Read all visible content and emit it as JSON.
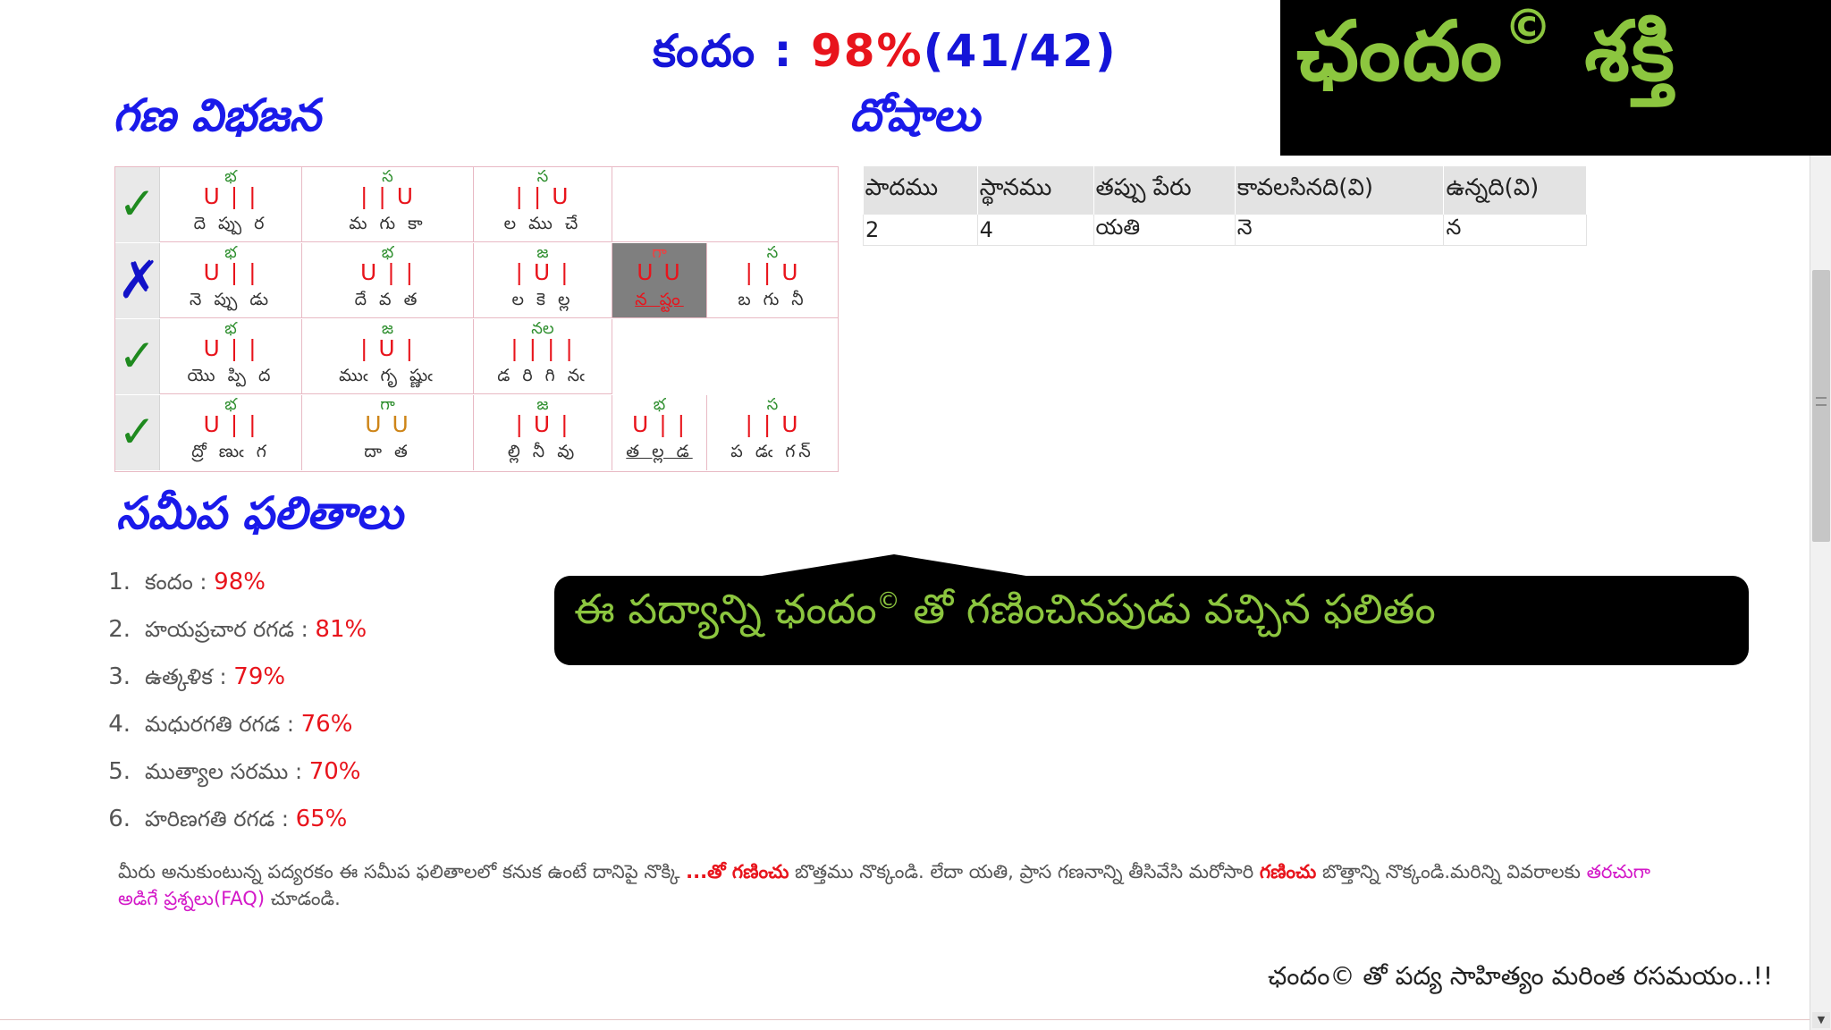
{
  "result": {
    "label": "కందం :",
    "percent": "98%",
    "count": "(41/42)"
  },
  "logo": {
    "main": "ఛందం",
    "copyright": "©",
    "suffix": "శక్తి"
  },
  "headings": {
    "gana_vibhajana": "గణ విభజన",
    "doshalu": "దోషాలు",
    "sameepa_phalitalu": "సమీప ఫలితాలు"
  },
  "gana_rows": [
    {
      "status": "✓",
      "ok": true,
      "cells": [
        {
          "name": "భ",
          "pattern": "U | |",
          "word": "దె ప్పు ర"
        },
        {
          "name": "స",
          "pattern": "| | U",
          "word": "మ గు కా"
        },
        {
          "name": "స",
          "pattern": "| | U",
          "word": "ల ము చే"
        }
      ]
    },
    {
      "status": "✗",
      "ok": false,
      "cells": [
        {
          "name": "భ",
          "pattern": "U | |",
          "word": "నె ప్పు డు"
        },
        {
          "name": "భ",
          "pattern": "U | |",
          "word": "దే వ త"
        },
        {
          "name": "జ",
          "pattern": "| U |",
          "word": "ల కె ల్ల"
        },
        {
          "name": "గా",
          "pattern": "U U",
          "word": "న ష్టం"
        },
        {
          "name": "స",
          "pattern": "| | U",
          "word": "బ గు నీ"
        }
      ]
    },
    {
      "status": "✓",
      "ok": true,
      "cells": [
        {
          "name": "భ",
          "pattern": "U | |",
          "word": "యొ ప్పి ద"
        },
        {
          "name": "జ",
          "pattern": "| U |",
          "word": "ముఁ గృ ష్ణుఁ"
        },
        {
          "name": "నల",
          "pattern": "| | | |",
          "word": "డ రి గి నఁ"
        }
      ]
    },
    {
      "status": "✓",
      "ok": true,
      "cells": [
        {
          "name": "భ",
          "pattern": "U | |",
          "word": "ద్రో ణుఁ గ"
        },
        {
          "name": "గా",
          "pattern": "U U",
          "word": "దా త"
        },
        {
          "name": "జ",
          "pattern": "| U |",
          "word": "ల్లి నీ వు"
        },
        {
          "name": "భ",
          "pattern": "U | |",
          "word": "త ల్ల డ"
        },
        {
          "name": "స",
          "pattern": "| | U",
          "word": "ప డఁ గన్"
        }
      ]
    }
  ],
  "dosha_table": {
    "headers": [
      "పాదము",
      "స్థానము",
      "తప్పు పేరు",
      "కావలసినది(వి)",
      "ఉన్నది(వి)"
    ],
    "rows": [
      [
        "2",
        "4",
        "యతి",
        "నె",
        "న"
      ]
    ]
  },
  "near_results": [
    {
      "num": "1.",
      "name": "కందం :",
      "pct": "98%"
    },
    {
      "num": "2.",
      "name": "హయప్రచార రగడ :",
      "pct": "81%"
    },
    {
      "num": "3.",
      "name": "ఉత్కళిక :",
      "pct": "79%"
    },
    {
      "num": "4.",
      "name": "మధురగతి రగడ :",
      "pct": "76%"
    },
    {
      "num": "5.",
      "name": "ముత్యాల సరము :",
      "pct": "70%"
    },
    {
      "num": "6.",
      "name": "హరిణగతి రగడ :",
      "pct": "65%"
    }
  ],
  "callout": {
    "before": "ఈ పద్యాన్ని ఛందం",
    "sup": "©",
    "after": " తో గణించినపుడు వచ్చిన ఫలితం"
  },
  "instructions": {
    "part1": "మీరు అనుకుంటున్న పద్యరకం ఈ సమీప ఫలితాలలో కనుక ఉంటే దానిపై నొక్కి ",
    "btn1": "...తో గణించు",
    "part2": " బొత్తము నొక్కండి. లేదా యతి, ప్రాస గణనాన్ని తీసివేసి మరోసారి ",
    "btn2": "గణించు",
    "part3": " బొత్తాన్ని నొక్కండి.మరిన్ని వివరాలకు ",
    "faq": "తరచుగా అడిగే ప్రశ్నలు(FAQ)",
    "part4": " చూడండి."
  },
  "footer": {
    "tagline": "ఛందం© తో పద్య సాహిత్యం మరింత రసమయం..!!"
  },
  "colors": {
    "blue": "#1515d8",
    "red": "#e8141c",
    "green_logo": "#8cc63f",
    "check_green": "#1f8a1f",
    "magenta": "#d319c8"
  }
}
